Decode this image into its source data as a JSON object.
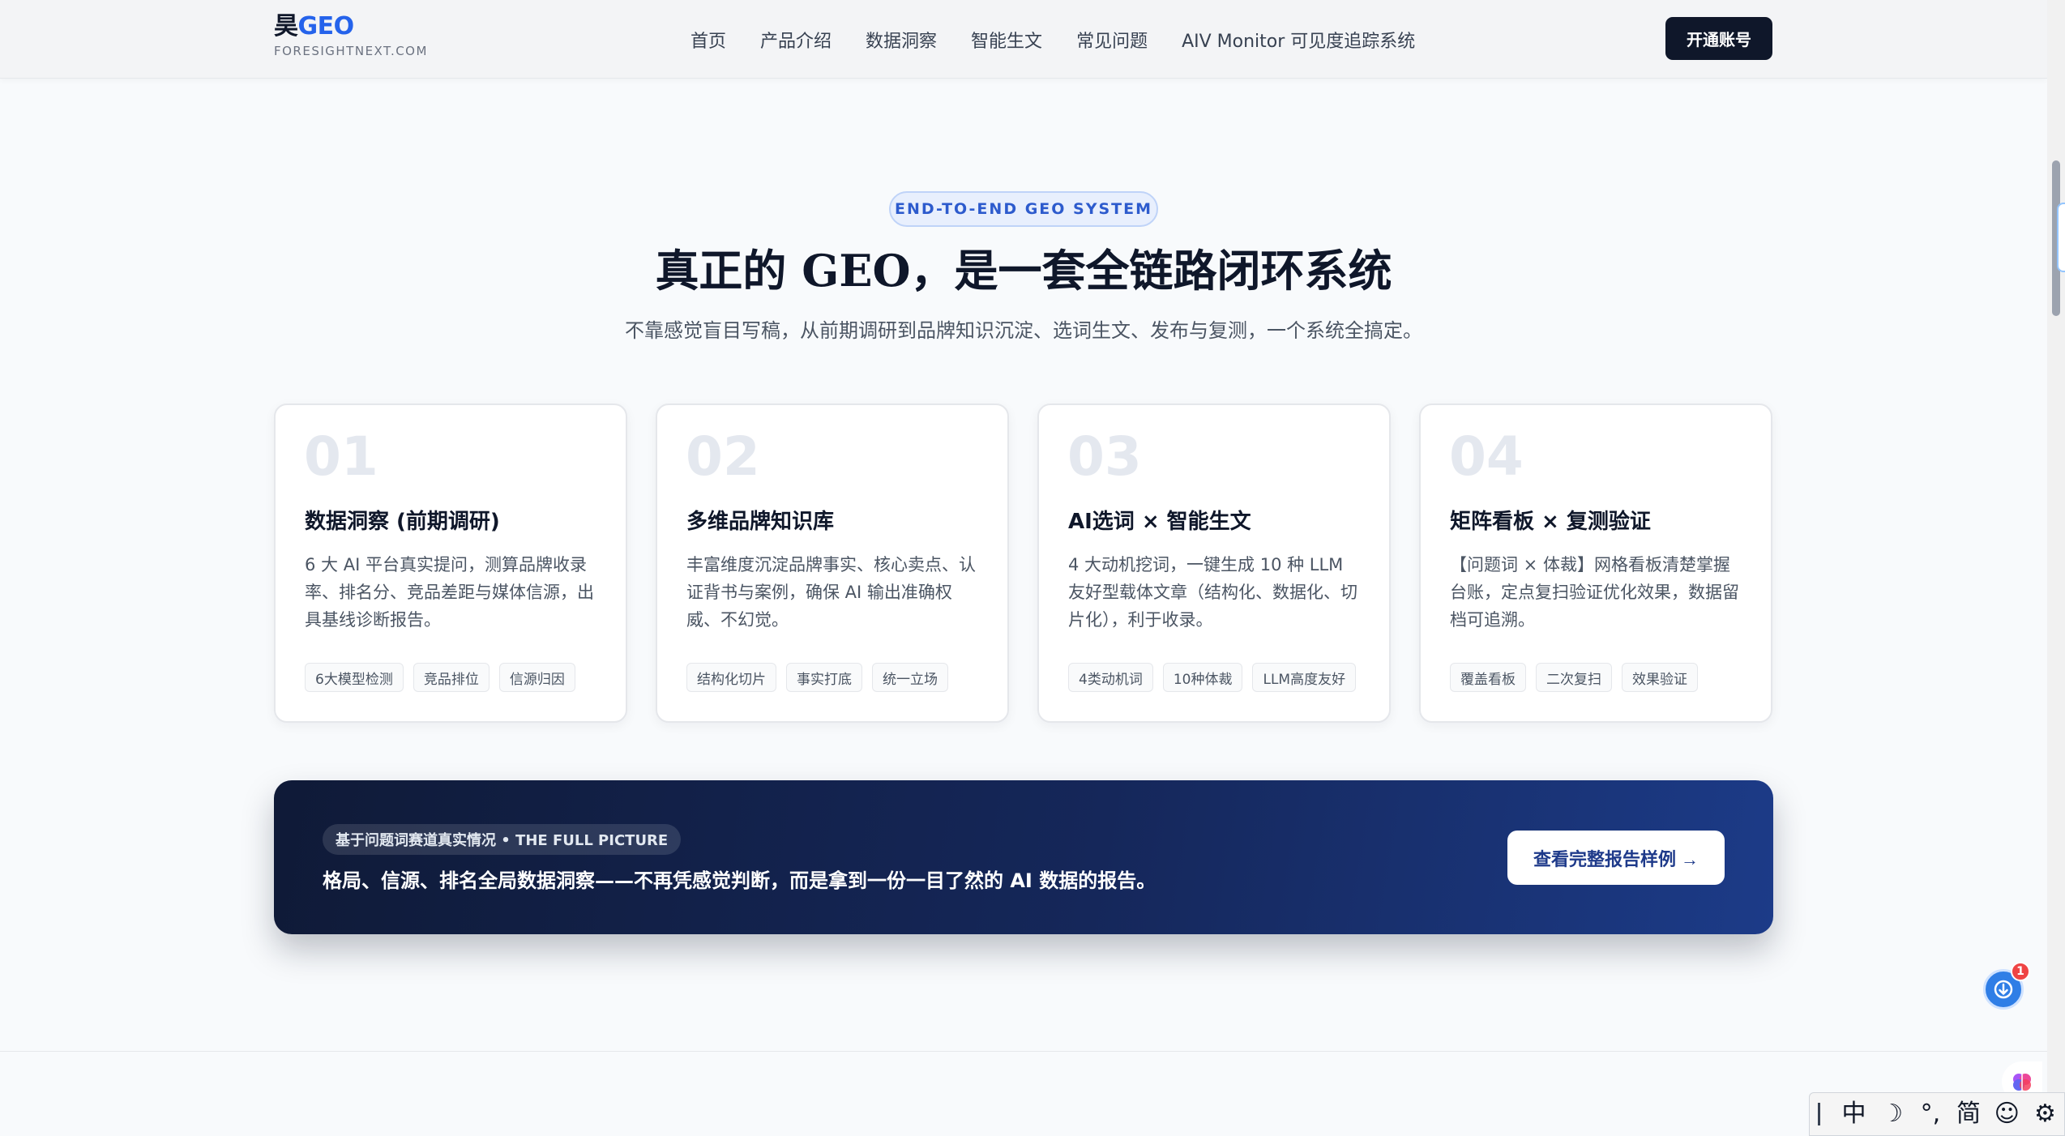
{
  "header": {
    "brand_prefix": "昊",
    "brand_accent": "GEO",
    "brand_sub": "FORESIGHTNEXT.COM",
    "nav": [
      "首页",
      "产品介绍",
      "数据洞察",
      "智能生文",
      "常见问题",
      "AIV Monitor 可见度追踪系统"
    ],
    "cta_label": "开通账号"
  },
  "hero": {
    "badge": "END-TO-END GEO SYSTEM",
    "title": "真正的 GEO，是一套全链路闭环系统",
    "subtitle": "不靠感觉盲目写稿，从前期调研到品牌知识沉淀、选词生文、发布与复测，一个系统全搞定。"
  },
  "cards": [
    {
      "num": "01",
      "title": "数据洞察 (前期调研)",
      "desc": "6 大 AI 平台真实提问，测算品牌收录率、排名分、竞品差距与媒体信源，出具基线诊断报告。",
      "tags": [
        "6大模型检测",
        "竞品排位",
        "信源归因"
      ]
    },
    {
      "num": "02",
      "title": "多维品牌知识库",
      "desc": "丰富维度沉淀品牌事实、核心卖点、认证背书与案例，确保 AI 输出准确权威、不幻觉。",
      "tags": [
        "结构化切片",
        "事实打底",
        "统一立场"
      ]
    },
    {
      "num": "03",
      "title": "AI选词 × 智能生文",
      "desc": "4 大动机挖词，一键生成 10 种 LLM 友好型载体文章（结构化、数据化、切片化），利于收录。",
      "tags": [
        "4类动机词",
        "10种体裁",
        "LLM高度友好"
      ]
    },
    {
      "num": "04",
      "title": "矩阵看板 × 复测验证",
      "desc": "【问题词 × 体裁】网格看板清楚掌握台账，定点复扫验证优化效果，数据留档可追溯。",
      "tags": [
        "覆盖看板",
        "二次复扫",
        "效果验证"
      ]
    }
  ],
  "banner": {
    "badge": "基于问题词赛道真实情况 • THE FULL PICTURE",
    "text": "格局、信源、排名全局数据洞察——不再凭感觉判断，而是拿到一份一目了然的 AI 数据的报告。",
    "button": "查看完整报告样例 →"
  },
  "widgets": {
    "notification_count": "1",
    "ime": [
      "中",
      "☽",
      "°,",
      "简",
      "☺",
      "⚙"
    ]
  },
  "colors": {
    "accent": "#2563eb",
    "dark": "#0f172a",
    "banner_start": "#0f1a37",
    "banner_end": "#1c3b88"
  }
}
